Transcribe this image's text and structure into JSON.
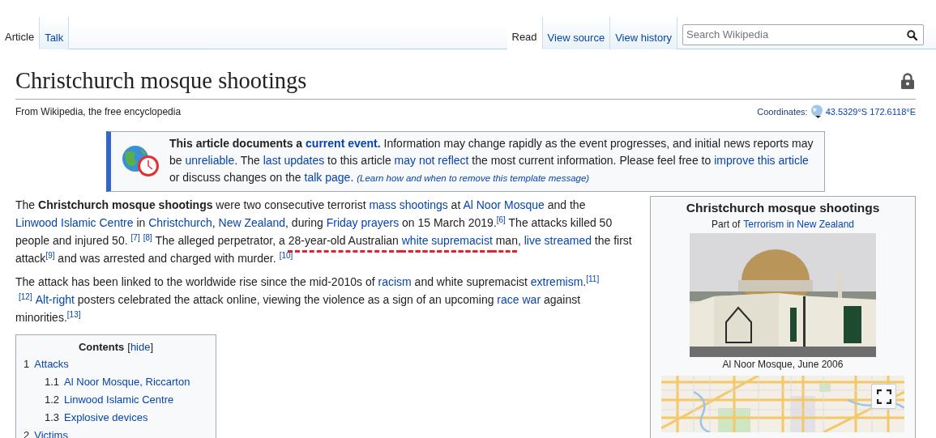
{
  "tabs_left": [
    {
      "label": "Article",
      "selected": true
    },
    {
      "label": "Talk",
      "selected": false
    }
  ],
  "tabs_right": [
    {
      "label": "Read",
      "selected": true
    },
    {
      "label": "View source",
      "selected": false
    },
    {
      "label": "View history",
      "selected": false
    }
  ],
  "search": {
    "placeholder": "Search Wikipedia"
  },
  "title": "Christchurch mosque shootings",
  "tagline": "From Wikipedia, the free encyclopedia",
  "coordinates": {
    "label": "Coordinates:",
    "value": "43.5329°S 172.6118°E"
  },
  "notice": {
    "segments": [
      {
        "kind": "bold",
        "text": "This article documents a "
      },
      {
        "kind": "boldlink",
        "text": "current event."
      },
      {
        "kind": "plain",
        "text": " Information may change rapidly as the event progresses, and initial news reports may be "
      },
      {
        "kind": "link",
        "text": "unreliable"
      },
      {
        "kind": "plain",
        "text": ". The "
      },
      {
        "kind": "link",
        "text": "last updates"
      },
      {
        "kind": "plain",
        "text": " to this article "
      },
      {
        "kind": "link",
        "text": "may not reflect"
      },
      {
        "kind": "plain",
        "text": " the most current information. Please feel free to "
      },
      {
        "kind": "link",
        "text": "improve this article"
      },
      {
        "kind": "plain",
        "text": " or discuss changes on the "
      },
      {
        "kind": "link",
        "text": "talk page"
      },
      {
        "kind": "plain",
        "text": ". "
      },
      {
        "kind": "note",
        "text": "(Learn how and when to remove this template message)"
      }
    ]
  },
  "paragraphs": [
    {
      "segments": [
        {
          "kind": "plain",
          "text": "The "
        },
        {
          "kind": "bold",
          "text": "Christchurch mosque shootings"
        },
        {
          "kind": "plain",
          "text": " were two consecutive terrorist "
        },
        {
          "kind": "link",
          "text": "mass shootings"
        },
        {
          "kind": "plain",
          "text": " at "
        },
        {
          "kind": "link",
          "text": "Al Noor Mosque"
        },
        {
          "kind": "plain",
          "text": " and the "
        },
        {
          "kind": "link",
          "text": "Linwood Islamic Centre"
        },
        {
          "kind": "plain",
          "text": " in "
        },
        {
          "kind": "link",
          "text": "Christchurch"
        },
        {
          "kind": "plain",
          "text": ", "
        },
        {
          "kind": "link",
          "text": "New Zealand"
        },
        {
          "kind": "plain",
          "text": ", during "
        },
        {
          "kind": "link",
          "text": "Friday prayers"
        },
        {
          "kind": "plain",
          "text": " on 15 March 2019."
        },
        {
          "kind": "ref",
          "text": "[6]"
        },
        {
          "kind": "plain",
          "text": " The attacks killed 50 people and injured 50."
        },
        {
          "kind": "ref",
          "text": "[7]"
        },
        {
          "kind": "ref",
          "text": "[8]"
        },
        {
          "kind": "plain",
          "text": " The alleged perpetrator, a "
        },
        {
          "kind": "underlined",
          "segments": [
            {
              "kind": "plain",
              "text": "28-year-old Australian "
            },
            {
              "kind": "link",
              "text": "white supremacist"
            },
            {
              "kind": "plain",
              "text": " man"
            }
          ]
        },
        {
          "kind": "plain",
          "text": ", "
        },
        {
          "kind": "link",
          "text": "live streamed"
        },
        {
          "kind": "plain",
          "text": " the first attack"
        },
        {
          "kind": "ref",
          "text": "[9]"
        },
        {
          "kind": "plain",
          "text": " and was arrested and charged with murder."
        },
        {
          "kind": "ref",
          "text": "[10]"
        }
      ]
    },
    {
      "segments": [
        {
          "kind": "plain",
          "text": "The attack has been linked to the worldwide rise since the mid-2010s of "
        },
        {
          "kind": "link",
          "text": "racism"
        },
        {
          "kind": "plain",
          "text": " and white supremacist "
        },
        {
          "kind": "link",
          "text": "extremism"
        },
        {
          "kind": "plain",
          "text": "."
        },
        {
          "kind": "ref",
          "text": "[11]"
        },
        {
          "kind": "ref",
          "text": "[12]"
        },
        {
          "kind": "link",
          "text": "Alt-right"
        },
        {
          "kind": "plain",
          "text": " posters celebrated the attack online, viewing the violence as a sign of an upcoming "
        },
        {
          "kind": "link",
          "text": "race war"
        },
        {
          "kind": "plain",
          "text": " against minorities."
        },
        {
          "kind": "ref",
          "text": "[13]"
        }
      ]
    }
  ],
  "contents": {
    "title": "Contents",
    "toggle": [
      {
        "kind": "plain",
        "text": "["
      },
      {
        "kind": "link",
        "text": "hide"
      },
      {
        "kind": "plain",
        "text": "]"
      }
    ],
    "items": [
      {
        "number": "1",
        "label": "Attacks",
        "children": [
          {
            "number": "1.1",
            "label": "Al Noor Mosque, Riccarton"
          },
          {
            "number": "1.2",
            "label": "Linwood Islamic Centre"
          },
          {
            "number": "1.3",
            "label": "Explosive devices"
          }
        ]
      },
      {
        "number": "2",
        "label": "Victims"
      }
    ]
  },
  "infobox": {
    "title": "Christchurch mosque shootings",
    "part_of": "Part of",
    "part_link": "Terrorism in New Zealand",
    "image": {
      "kind": "picture",
      "caption": "Al Noor Mosque, June 2006"
    }
  }
}
